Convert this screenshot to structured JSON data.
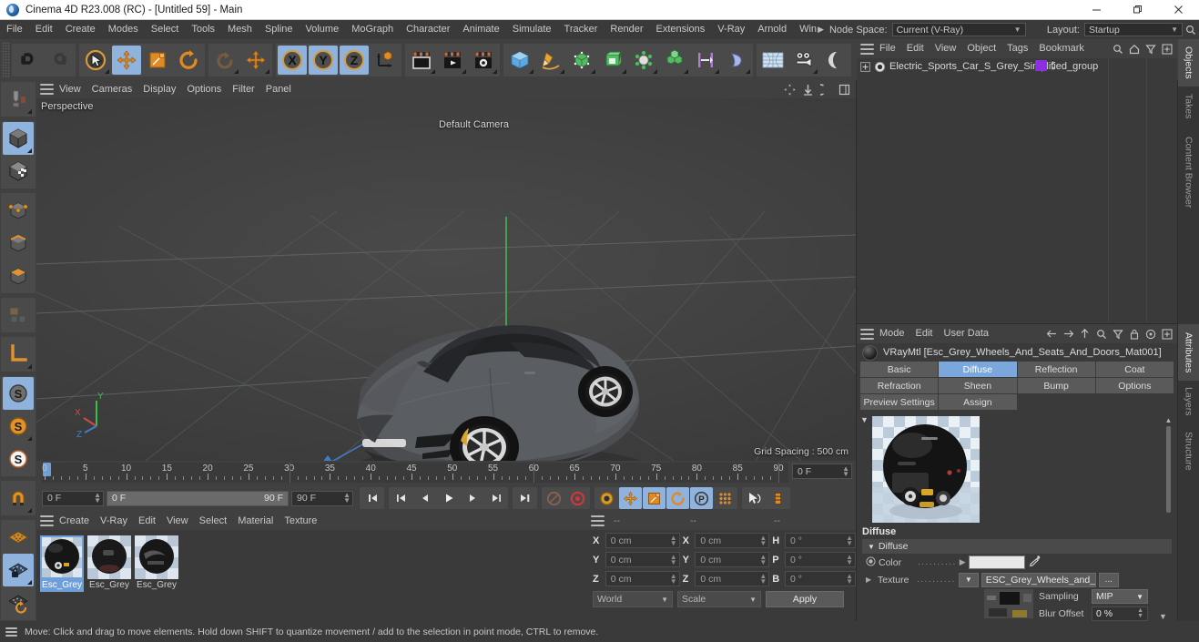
{
  "window": {
    "title": "Cinema 4D R23.008 (RC) - [Untitled 59] - Main",
    "minimize": "minimize-button",
    "maximize": "maximize-button",
    "close": "close-button"
  },
  "menubar": {
    "items": [
      "File",
      "Edit",
      "Create",
      "Modes",
      "Select",
      "Tools",
      "Mesh",
      "Spline",
      "Volume",
      "MoGraph",
      "Character",
      "Animate",
      "Simulate",
      "Tracker",
      "Render",
      "Extensions",
      "V-Ray",
      "Arnold",
      "Window"
    ],
    "node_space_label": "Node Space:",
    "node_space_value": "Current (V-Ray)",
    "layout_label": "Layout:",
    "layout_value": "Startup"
  },
  "viewport": {
    "menu": [
      "View",
      "Cameras",
      "Display",
      "Options",
      "Filter",
      "Panel"
    ],
    "perspective_label": "Perspective",
    "camera_label": "Default Camera",
    "grid_spacing": "Grid Spacing : 500 cm",
    "axis_x": "X",
    "axis_y": "Y",
    "axis_z": "Z"
  },
  "timeline": {
    "ticks": [
      0,
      5,
      10,
      15,
      20,
      25,
      30,
      35,
      40,
      45,
      50,
      55,
      60,
      65,
      70,
      75,
      80,
      85,
      90
    ],
    "current_frame": "0 F",
    "start_field": "0 F",
    "preview_start": "0 F",
    "preview_end": "90 F",
    "end_field": "90 F"
  },
  "material_manager": {
    "menu": [
      "Create",
      "V-Ray",
      "Edit",
      "View",
      "Select",
      "Material",
      "Texture"
    ],
    "materials": [
      {
        "name": "Esc_Grey",
        "selected": true
      },
      {
        "name": "Esc_Grey",
        "selected": false
      },
      {
        "name": "Esc_Grey",
        "selected": false
      }
    ]
  },
  "coordinates": {
    "headers": [
      "--",
      "--",
      "--"
    ],
    "rows": [
      {
        "pos_label": "X",
        "pos_value": "0 cm",
        "size_label": "X",
        "size_value": "0 cm",
        "rot_label": "H",
        "rot_value": "0 °"
      },
      {
        "pos_label": "Y",
        "pos_value": "0 cm",
        "size_label": "Y",
        "size_value": "0 cm",
        "rot_label": "P",
        "rot_value": "0 °"
      },
      {
        "pos_label": "Z",
        "pos_value": "0 cm",
        "size_label": "Z",
        "size_value": "0 cm",
        "rot_label": "B",
        "rot_value": "0 °"
      }
    ],
    "system": "World",
    "mode": "Scale",
    "apply": "Apply"
  },
  "objects_panel": {
    "menu": [
      "File",
      "Edit",
      "View",
      "Object",
      "Tags",
      "Bookmarks"
    ],
    "items": [
      {
        "name": "Electric_Sports_Car_S_Grey_Simplified_group",
        "tag_color": "#8b2fe0"
      }
    ]
  },
  "attributes_panel": {
    "menu": [
      "Mode",
      "Edit",
      "User Data"
    ],
    "material_title": "VRayMtl [Esc_Grey_Wheels_And_Seats_And_Doors_Mat001]",
    "tabs": [
      {
        "label": "Basic",
        "active": false
      },
      {
        "label": "Diffuse",
        "active": true
      },
      {
        "label": "Reflection",
        "active": false
      },
      {
        "label": "Coat",
        "active": false
      },
      {
        "label": "Refraction",
        "active": false
      },
      {
        "label": "Sheen",
        "active": false
      },
      {
        "label": "Bump",
        "active": false
      },
      {
        "label": "Options",
        "active": false
      },
      {
        "label": "Preview Settings",
        "active": false
      },
      {
        "label": "Assign",
        "active": false
      }
    ],
    "section_title": "Diffuse",
    "group_title": "Diffuse",
    "color_label": "Color",
    "color_value": "#e8e8e8",
    "texture_label": "Texture",
    "texture_value": "ESC_Grey_Wheels_and_Seat",
    "texture_browse": "...",
    "sampling_label": "Sampling",
    "sampling_value": "MIP",
    "blur_offset_label": "Blur Offset",
    "blur_offset_value": "0 %"
  },
  "right_tabs": [
    {
      "label": "Objects",
      "active": true
    },
    {
      "label": "Takes",
      "active": false
    },
    {
      "label": "Content Browser",
      "active": false
    },
    {
      "label": "Attributes",
      "active": true
    },
    {
      "label": "Layers",
      "active": false
    },
    {
      "label": "Structure",
      "active": false
    }
  ],
  "statusbar": {
    "message": "Move: Click and drag to move elements. Hold down SHIFT to quantize movement / add to the selection in point mode, CTRL to remove."
  }
}
